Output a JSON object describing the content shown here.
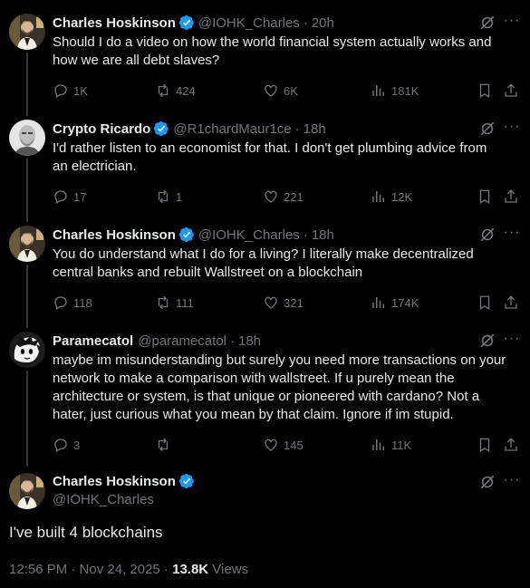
{
  "colors": {
    "background": "#000000",
    "text_primary": "#e7e9ea",
    "text_secondary": "#71767b",
    "verified_blue": "#1d9bf0",
    "thread_line": "#333639"
  },
  "replies": [
    {
      "name": "Charles Hoskinson",
      "handle": "@IOHK_Charles",
      "time": "20h",
      "text": "Should I do a video on how the world financial system actually works and\nhow we are all debt slaves?",
      "replies": "1K",
      "reposts": "424",
      "likes": "6K",
      "views": "181K"
    },
    {
      "name": "Crypto Ricardo",
      "handle": "@R1chardMaur1ce",
      "time": "18h",
      "text": "I'd rather listen to an economist for that.  I don't get plumbing advice from\nan electrician.",
      "replies": "17",
      "reposts": "1",
      "likes": "221",
      "views": "12K"
    },
    {
      "name": "Charles Hoskinson",
      "handle": "@IOHK_Charles",
      "time": "18h",
      "text": "You do understand what I do for a living? I literally make decentralized\ncentral banks and rebuilt Wallstreet on a blockchain",
      "replies": "118",
      "reposts": "111",
      "likes": "321",
      "views": "174K"
    },
    {
      "name": "Paramecatol",
      "handle": "@paramecatol",
      "time": "18h",
      "text": "maybe im misunderstanding but surely you need more transactions on your\nnetwork to make a comparison with wallstreet. If u purely mean the\narchitecture or system, is that unique or pioneered with cardano? Not a\nhater, just curious what you mean by that claim. Ignore if im stupid.",
      "replies": "3",
      "reposts": "",
      "likes": "145",
      "views": "11K"
    }
  ],
  "main_tweet": {
    "name": "Charles Hoskinson",
    "handle": "@IOHK_Charles",
    "text": "I've built 4 blockchains",
    "timestamp": "12:56 PM · Nov 24, 2025 · ",
    "views_count": "13.8K",
    "views_label": " Views"
  },
  "icons": {
    "reply": "reply-icon",
    "repost": "repost-icon",
    "like": "heart-icon",
    "views": "views-icon",
    "bookmark": "bookmark-icon",
    "share": "share-icon",
    "grok": "grok-icon",
    "more": "more-icon",
    "verified": "verified-badge-icon"
  }
}
